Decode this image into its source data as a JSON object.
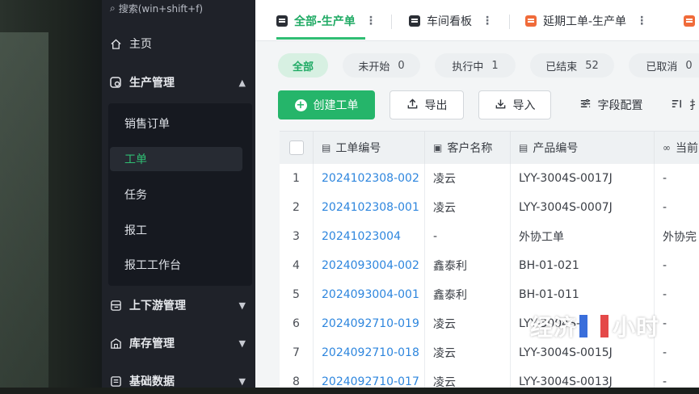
{
  "sidebar": {
    "search_placeholder": "搜索(win+shift+f)",
    "home_label": "主页",
    "production_label": "生产管理",
    "sub_items": [
      {
        "label": "销售订单"
      },
      {
        "label": "工单"
      },
      {
        "label": "任务"
      },
      {
        "label": "报工"
      },
      {
        "label": "报工工作台"
      }
    ],
    "supply_label": "上下游管理",
    "inventory_label": "库存管理",
    "basic_data_label": "基础数据"
  },
  "tabs": [
    {
      "label": "全部-生产单",
      "active": true
    },
    {
      "label": "车间看板",
      "active": false
    },
    {
      "label": "延期工单-生产单",
      "active": false
    }
  ],
  "filters": [
    {
      "label": "全部",
      "count": ""
    },
    {
      "label": "未开始",
      "count": "0"
    },
    {
      "label": "执行中",
      "count": "1"
    },
    {
      "label": "已结束",
      "count": "52"
    },
    {
      "label": "已取消",
      "count": "0"
    }
  ],
  "toolbar": {
    "create_label": "创建工单",
    "export_label": "导出",
    "import_label": "导入",
    "fields_label": "字段配置",
    "partial_label": "扌"
  },
  "table": {
    "columns": [
      "工单编号",
      "客户名称",
      "产品编号",
      "当前"
    ],
    "rows": [
      {
        "index": "1",
        "order": "2024102308-002",
        "customer": "凌云",
        "product": "LYY-3004S-0017J",
        "current": "-"
      },
      {
        "index": "2",
        "order": "2024102308-001",
        "customer": "凌云",
        "product": "LYY-3004S-0007J",
        "current": "-"
      },
      {
        "index": "3",
        "order": "20241023004",
        "customer": "-",
        "product": "外协工单",
        "current": "外协完"
      },
      {
        "index": "4",
        "order": "2024093004-002",
        "customer": "鑫泰利",
        "product": "BH-01-021",
        "current": "-"
      },
      {
        "index": "5",
        "order": "2024093004-001",
        "customer": "鑫泰利",
        "product": "BH-01-011",
        "current": "-"
      },
      {
        "index": "6",
        "order": "2024092710-019",
        "customer": "凌云",
        "product": "LYY-3004S-",
        "current": "-"
      },
      {
        "index": "7",
        "order": "2024092710-018",
        "customer": "凌云",
        "product": "LYY-3004S-0015J",
        "current": "-"
      },
      {
        "index": "8",
        "order": "2024092710-017",
        "customer": "凌云",
        "product": "LYY-3004S-0013J",
        "current": "-"
      }
    ]
  },
  "watermark": {
    "left": "经济",
    "right": "小时"
  },
  "colors": {
    "accent": "#25b56a",
    "link": "#2e86de",
    "sidebar": "#1f2229"
  }
}
